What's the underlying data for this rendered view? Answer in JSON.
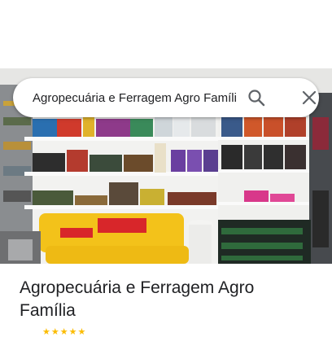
{
  "search": {
    "query": "Agropecuária e Ferragem Agro Família"
  },
  "place": {
    "name": "Agropecuária e Ferragem Agro Família"
  },
  "icons": {
    "search": "search-icon",
    "close": "close-icon",
    "star": "star-icon"
  },
  "colors": {
    "star": "#fbbc04",
    "text": "#202124",
    "icon": "#5f6368"
  }
}
